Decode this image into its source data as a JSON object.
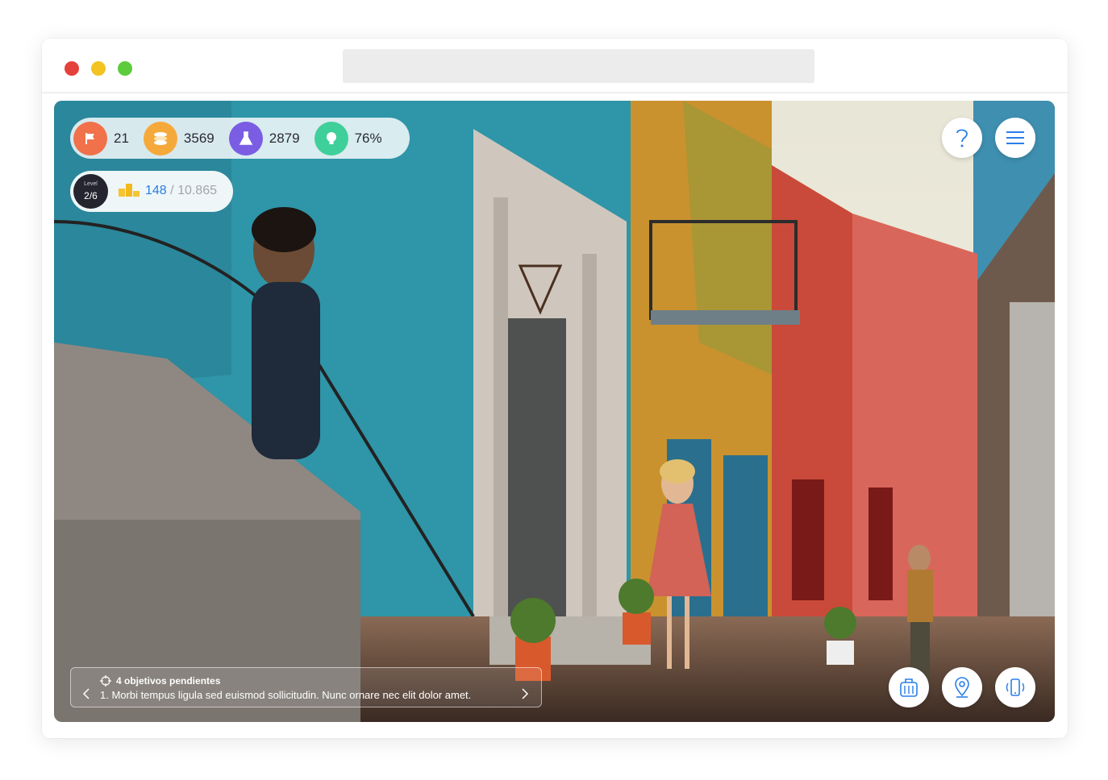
{
  "browser": {
    "url": ""
  },
  "hud": {
    "stats": [
      {
        "icon": "flag-icon",
        "value": "21",
        "color": "#f0714a"
      },
      {
        "icon": "coins-icon",
        "value": "3569",
        "color": "#f6a93b"
      },
      {
        "icon": "flask-icon",
        "value": "2879",
        "color": "#7a5de3"
      },
      {
        "icon": "lightbulb-icon",
        "value": "76%",
        "color": "#3fcf9a"
      }
    ],
    "level": {
      "label": "Level",
      "value": "2/6",
      "score_current": "148",
      "score_separator": "/",
      "score_max": "10.865"
    }
  },
  "objectives": {
    "title": "4 objetivos pendientes",
    "current": "1. Morbi tempus ligula sed euismod sollicitudin. Nunc ornare nec elit dolor amet."
  },
  "controls": {
    "top": [
      "help-icon",
      "menu-icon"
    ],
    "bottom": [
      "backpack-icon",
      "map-pin-icon",
      "phone-vibrate-icon"
    ]
  },
  "colors": {
    "accent": "#2a7ee8",
    "dark": "#24252f"
  }
}
